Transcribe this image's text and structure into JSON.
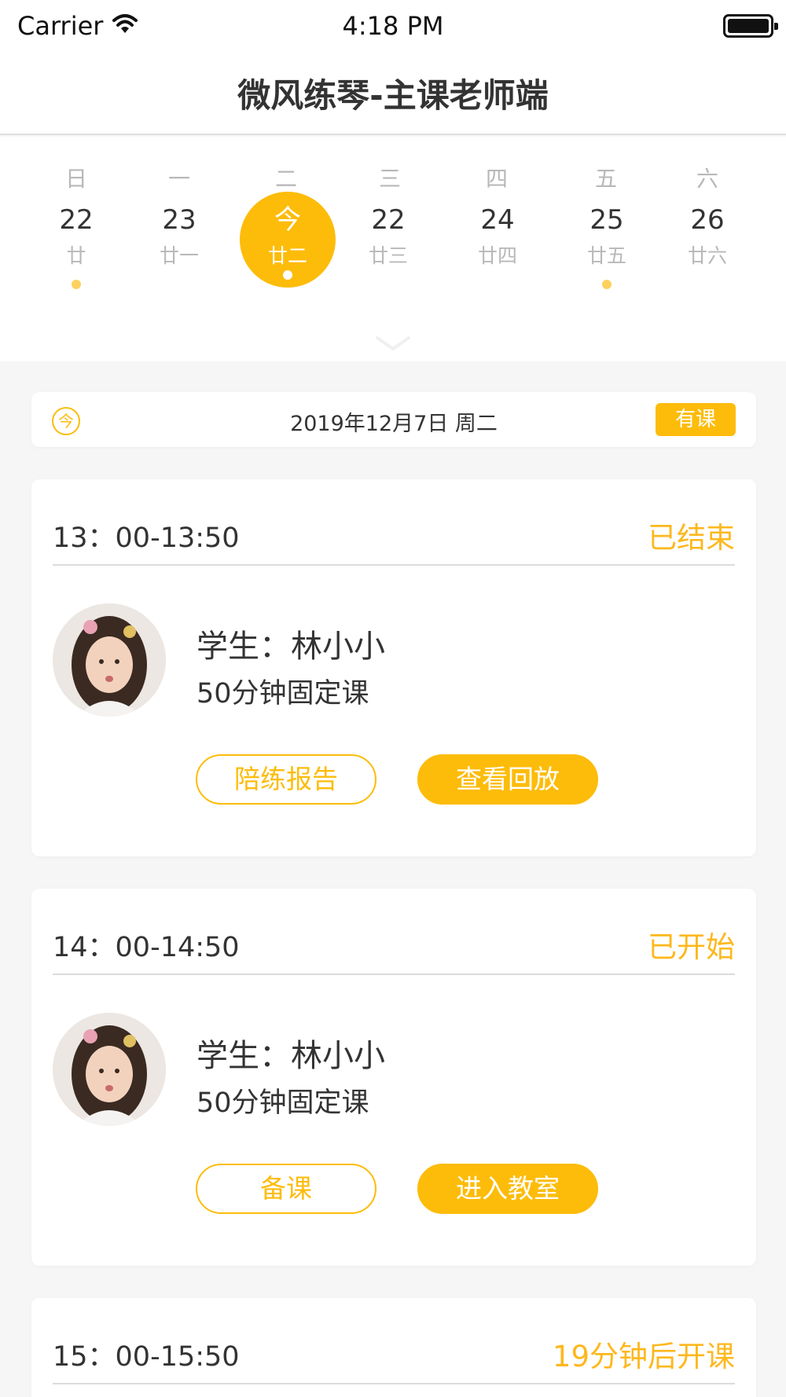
{
  "status_bar": {
    "carrier": "Carrier",
    "time": "4:18 PM"
  },
  "nav": {
    "title": "微风练琴-主课老师端"
  },
  "calendar": {
    "weekdays": [
      "日",
      "一",
      "二",
      "三",
      "四",
      "五",
      "六"
    ],
    "days": [
      {
        "number": "22",
        "lunar": "廿",
        "has_class": true,
        "today": false
      },
      {
        "number": "23",
        "lunar": "廿一",
        "has_class": false,
        "today": false
      },
      {
        "number": "今",
        "lunar": "廿二",
        "has_class": true,
        "today": true
      },
      {
        "number": "22",
        "lunar": "廿三",
        "has_class": false,
        "today": false
      },
      {
        "number": "24",
        "lunar": "廿四",
        "has_class": false,
        "today": false
      },
      {
        "number": "25",
        "lunar": "廿五",
        "has_class": true,
        "today": false
      },
      {
        "number": "26",
        "lunar": "廿六",
        "has_class": false,
        "today": false
      }
    ]
  },
  "date_bar": {
    "icon_text": "今",
    "date": "2019年12月7日   周二",
    "badge": "有课"
  },
  "lessons": [
    {
      "time": "13：00-13:50",
      "status": "已结束",
      "student": "学生：林小小",
      "course": "50分钟固定课",
      "button_left": "陪练报告",
      "button_right": "查看回放"
    },
    {
      "time": "14：00-14:50",
      "status": "已开始",
      "student": "学生：林小小",
      "course": "50分钟固定课",
      "button_left": "备课",
      "button_right": "进入教室"
    },
    {
      "time": "15：00-15:50",
      "status": "19分钟后开课"
    }
  ],
  "colors": {
    "accent": "#fdbc0a",
    "status_text": "#fdb81e",
    "background": "#f6f6f6"
  }
}
